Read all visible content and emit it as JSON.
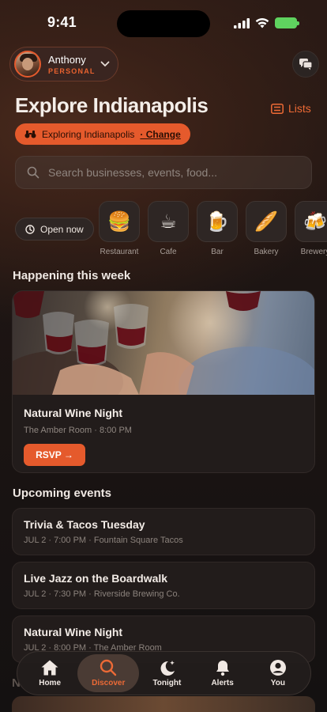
{
  "status": {
    "time": "9:41"
  },
  "profile": {
    "name": "Anthony",
    "role": "PERSONAL"
  },
  "header": {
    "title": "Explore Indianapolis",
    "lists_label": "Lists"
  },
  "location": {
    "text": "Exploring Indianapolis",
    "change_label": "· Change"
  },
  "search": {
    "placeholder": "Search businesses, events, food..."
  },
  "filters": {
    "open_now": "Open now"
  },
  "categories": [
    {
      "label": "Restaurant",
      "icon": "🍔"
    },
    {
      "label": "Cafe",
      "icon": "☕"
    },
    {
      "label": "Bar",
      "icon": "🍺"
    },
    {
      "label": "Bakery",
      "icon": "🥖"
    },
    {
      "label": "Brewery",
      "icon": "🍻"
    }
  ],
  "happening": {
    "heading": "Happening this week",
    "card": {
      "title": "Natural Wine Night",
      "subtitle": "The Amber Room · 8:00 PM",
      "button": "RSVP →"
    }
  },
  "upcoming": {
    "heading": "Upcoming events",
    "items": [
      {
        "title": "Trivia & Tacos Tuesday",
        "subtitle": "JUL 2 · 7:00 PM · Fountain Square Tacos"
      },
      {
        "title": "Live Jazz on the Boardwalk",
        "subtitle": "JUL 2 · 7:30 PM · Riverside Brewing Co."
      },
      {
        "title": "Natural Wine Night",
        "subtitle": "JUL 2 · 8:00 PM · The Amber Room"
      }
    ]
  },
  "next_section_peek": "N",
  "tabs": [
    {
      "label": "Home"
    },
    {
      "label": "Discover"
    },
    {
      "label": "Tonight"
    },
    {
      "label": "Alerts"
    },
    {
      "label": "You"
    }
  ],
  "colors": {
    "accent": "#e55a2c",
    "background": "#141111",
    "card": "#221c1b"
  }
}
